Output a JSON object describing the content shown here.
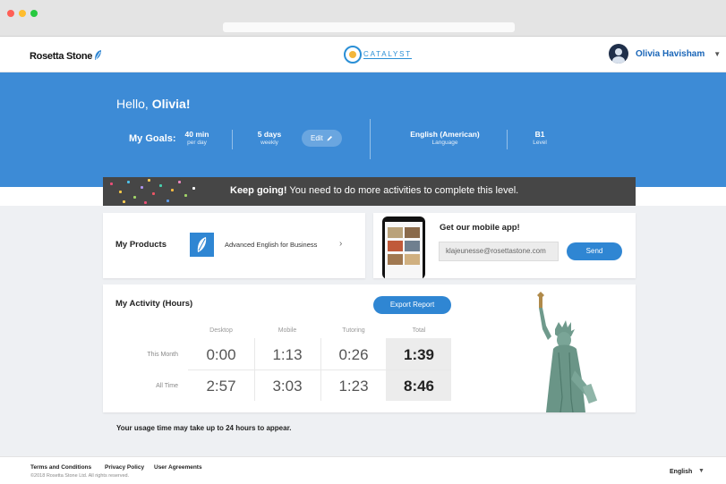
{
  "colors": {
    "brand_blue": "#3d8bd6",
    "button_blue": "#2f86d3",
    "banner_dark": "#464646",
    "page_grey": "#eef0f3",
    "traffic_red": "#ff5f56",
    "traffic_yellow": "#ffbd2e",
    "traffic_green": "#27c93f"
  },
  "header": {
    "brand": "Rosetta Stone",
    "catalyst": "CATALYST",
    "user_name": "Olivia Havisham"
  },
  "hero": {
    "greeting": "Hello,",
    "name": "Olivia!",
    "goals_label": "My Goals:",
    "goal1_value": "40 min",
    "goal1_unit": "per day",
    "goal2_value": "5 days",
    "goal2_unit": "weekly",
    "edit_label": "Edit",
    "language_value": "English (American)",
    "language_label": "Language",
    "level_value": "B1",
    "level_label": "Level"
  },
  "banner": {
    "strong": "Keep going!",
    "message": " You need to do more activities to complete this level."
  },
  "products": {
    "title": "My Products",
    "product_name": "Advanced English for Business"
  },
  "mobile": {
    "title": "Get our mobile app!",
    "email": "klajeunesse@rosettastone.com",
    "send_label": "Send"
  },
  "activity": {
    "title": "My Activity (Hours)",
    "export_label": "Export Report",
    "columns": [
      "Desktop",
      "Mobile",
      "Tutoring",
      "Total"
    ],
    "rows": [
      {
        "label": "This Month",
        "values": [
          "0:00",
          "1:13",
          "0:26",
          "1:39"
        ]
      },
      {
        "label": "All Time",
        "values": [
          "2:57",
          "3:03",
          "1:23",
          "8:46"
        ]
      }
    ]
  },
  "note": "Your usage time may take up to 24 hours to appear.",
  "footer": {
    "terms": "Terms and Conditions",
    "privacy": "Privacy Policy",
    "agreements": "User Agreements",
    "copyright": "©2018 Rosetta Stone Ltd.  All rights reserved.",
    "language": "English"
  }
}
